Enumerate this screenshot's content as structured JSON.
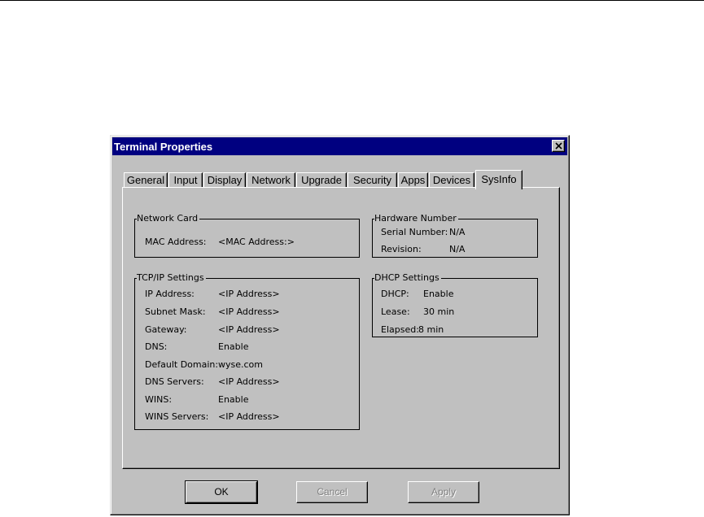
{
  "window": {
    "title": "Terminal Properties"
  },
  "tabs": [
    {
      "label": "General"
    },
    {
      "label": "Input"
    },
    {
      "label": "Display"
    },
    {
      "label": "Network"
    },
    {
      "label": "Upgrade"
    },
    {
      "label": "Security"
    },
    {
      "label": "Apps"
    },
    {
      "label": "Devices"
    },
    {
      "label": "SysInfo",
      "active": true
    }
  ],
  "network_card": {
    "legend": "Network Card",
    "mac_label": "MAC Address:",
    "mac_value": "<MAC Address:>"
  },
  "tcpip": {
    "legend": "TCP/IP Settings",
    "rows": [
      {
        "label": "IP Address:",
        "value": "<IP Address>"
      },
      {
        "label": "Subnet Mask:",
        "value": "<IP Address>"
      },
      {
        "label": "Gateway:",
        "value": "<IP Address>"
      },
      {
        "label": "DNS:",
        "value": "Enable"
      },
      {
        "label": "Default Domain:",
        "value": "wyse.com"
      },
      {
        "label": "DNS Servers:",
        "value": "<IP Address>"
      },
      {
        "label": "WINS:",
        "value": "Enable"
      },
      {
        "label": "WINS Servers:",
        "value": "<IP Address>"
      }
    ]
  },
  "hardware": {
    "legend": "Hardware Number",
    "rows": [
      {
        "label": "Serial Number:",
        "value": "N/A"
      },
      {
        "label": "Revision:",
        "value": "N/A"
      }
    ]
  },
  "dhcp": {
    "legend": "DHCP Settings",
    "rows": [
      {
        "label": "DHCP:",
        "value": "Enable"
      },
      {
        "label": "Lease:",
        "value": "30 min"
      },
      {
        "label": "Elapsed:",
        "value": "8 min"
      }
    ]
  },
  "buttons": {
    "ok": "OK",
    "cancel": "Cancel",
    "apply": "Apply"
  }
}
